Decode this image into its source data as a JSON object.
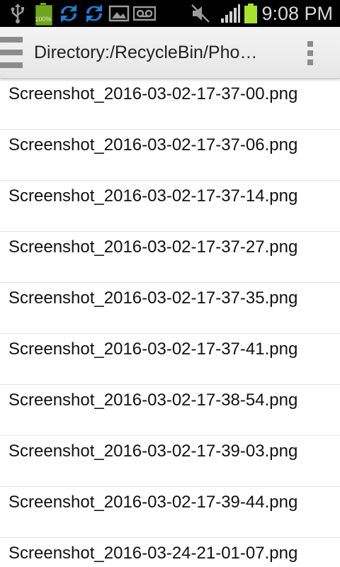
{
  "status_bar": {
    "battery_small_label": "100%",
    "time": "9:08 PM",
    "colors": {
      "background": "#000000",
      "battery": "#a6e22e",
      "accent_icon": "#1e88e5"
    },
    "icons": [
      "usb-icon",
      "battery-small-icon",
      "sync-icon",
      "sync-icon",
      "image-icon",
      "voicemail-icon",
      "mute-icon",
      "signal-icon",
      "battery-icon"
    ]
  },
  "app_bar": {
    "title": "Directory:/RecycleBin/Pho…",
    "icons": [
      "hamburger-menu-icon",
      "overflow-menu-icon"
    ]
  },
  "files": [
    {
      "name": "Screenshot_2016-03-02-17-37-00.png"
    },
    {
      "name": "Screenshot_2016-03-02-17-37-06.png"
    },
    {
      "name": "Screenshot_2016-03-02-17-37-14.png"
    },
    {
      "name": "Screenshot_2016-03-02-17-37-27.png"
    },
    {
      "name": "Screenshot_2016-03-02-17-37-35.png"
    },
    {
      "name": "Screenshot_2016-03-02-17-37-41.png"
    },
    {
      "name": "Screenshot_2016-03-02-17-38-54.png"
    },
    {
      "name": "Screenshot_2016-03-02-17-39-03.png"
    },
    {
      "name": "Screenshot_2016-03-02-17-39-44.png"
    },
    {
      "name": "Screenshot_2016-03-24-21-01-07.png"
    }
  ]
}
